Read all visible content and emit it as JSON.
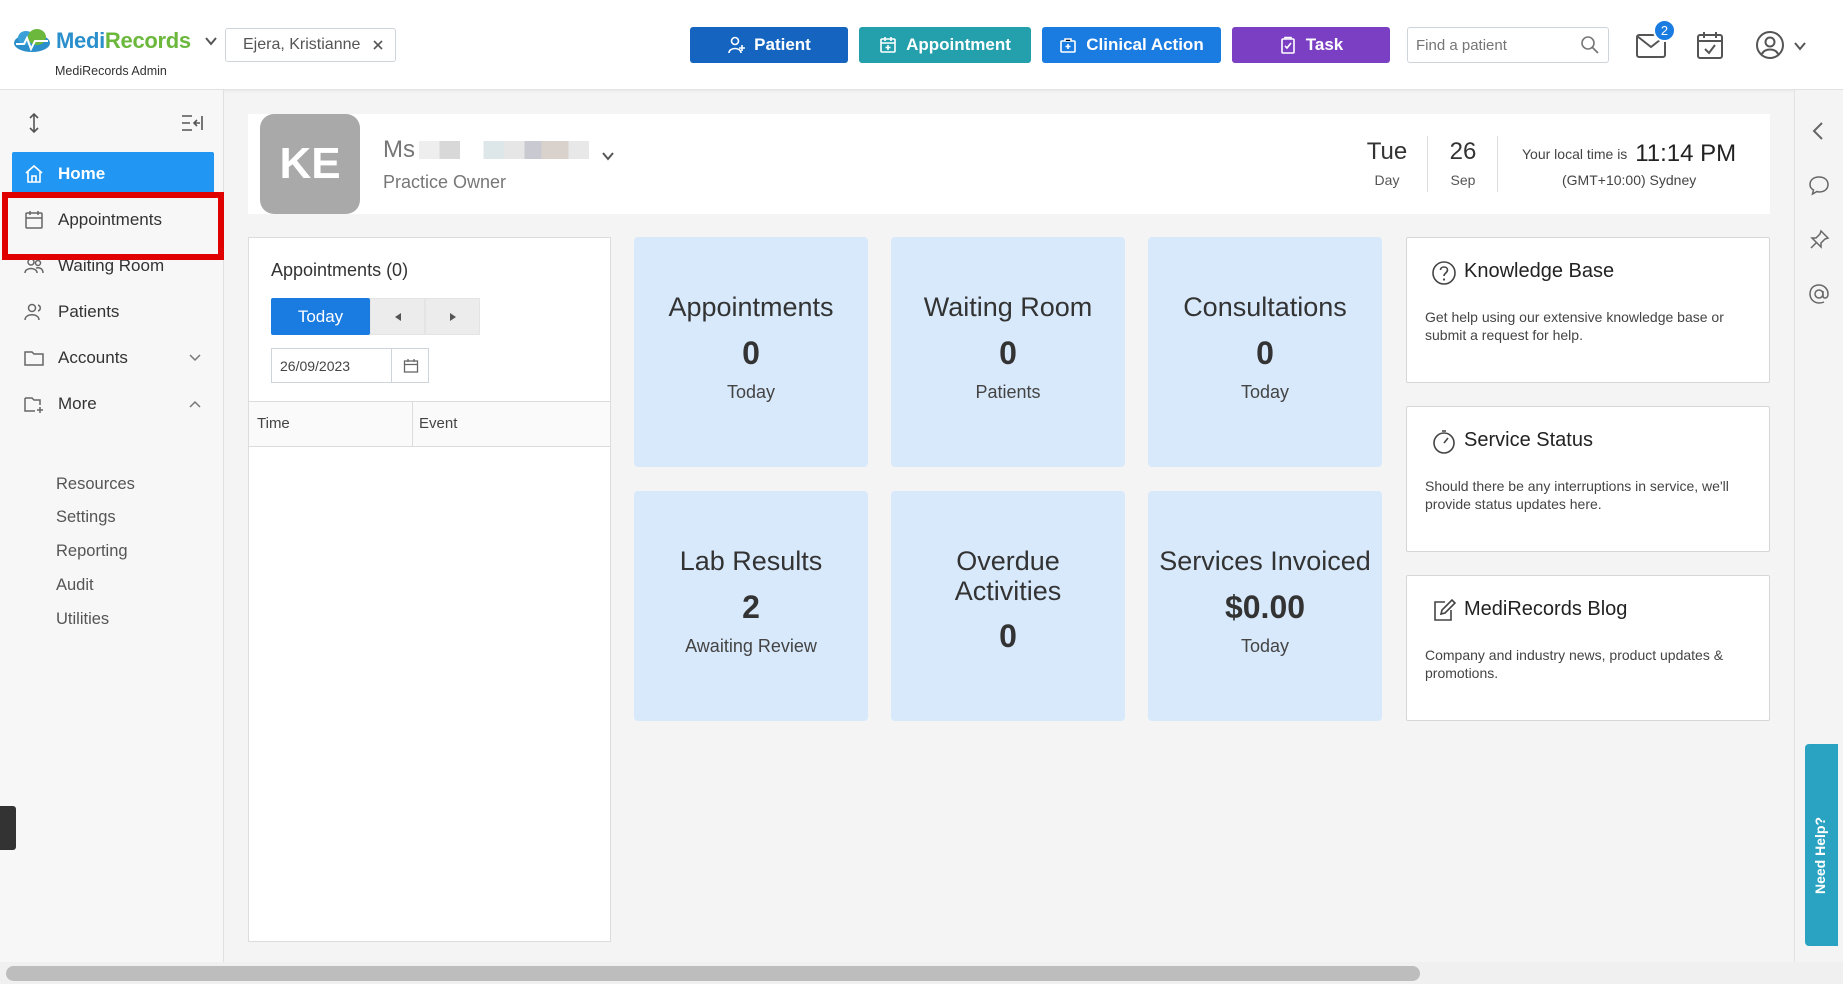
{
  "app": {
    "logo_main": "Medi",
    "logo_accent": "Records",
    "subtitle": "MediRecords Admin"
  },
  "topbar": {
    "patient_chip": "Ejera, Kristianne",
    "buttons": {
      "patient": "Patient",
      "appointment": "Appointment",
      "clinical_action": "Clinical Action",
      "task": "Task"
    },
    "search_placeholder": "Find a patient",
    "mail_badge": "2"
  },
  "sidebar": {
    "items": [
      {
        "label": "Home",
        "icon": "home-icon",
        "active": true
      },
      {
        "label": "Appointments",
        "icon": "calendar-icon"
      },
      {
        "label": "Waiting Room",
        "icon": "people-icon"
      },
      {
        "label": "Patients",
        "icon": "patients-icon"
      },
      {
        "label": "Accounts",
        "icon": "folder-icon"
      },
      {
        "label": "More",
        "icon": "more-icon"
      }
    ],
    "subitems": [
      "Resources",
      "Settings",
      "Reporting",
      "Audit",
      "Utilities"
    ]
  },
  "header": {
    "initials": "KE",
    "name_prefix": "Ms",
    "role": "Practice Owner",
    "day": "Tue",
    "day_label": "Day",
    "date": "26",
    "month": "Sep",
    "local_time_label": "Your local time is",
    "local_time": "11:14 PM",
    "timezone": "(GMT+10:00) Sydney"
  },
  "appointments_panel": {
    "title": "Appointments (0)",
    "today": "Today",
    "date": "26/09/2023",
    "col_time": "Time",
    "col_event": "Event"
  },
  "tiles": [
    {
      "title": "Appointments",
      "value": "0",
      "sub": "Today"
    },
    {
      "title": "Waiting Room",
      "value": "0",
      "sub": "Patients"
    },
    {
      "title": "Consultations",
      "value": "0",
      "sub": "Today"
    },
    {
      "title": "Lab Results",
      "value": "2",
      "sub": "Awaiting Review"
    },
    {
      "title": "Overdue Activities",
      "value": "0",
      "sub": ""
    },
    {
      "title": "Services Invoiced",
      "value": "$0.00",
      "sub": "Today"
    }
  ],
  "cards": [
    {
      "title": "Knowledge Base",
      "desc": "Get help using our extensive knowledge base or submit a request for help."
    },
    {
      "title": "Service Status",
      "desc": "Should there be any interruptions in service, we'll provide status updates here."
    },
    {
      "title": "MediRecords Blog",
      "desc": "Company and industry news, product updates & promotions."
    }
  ],
  "help_tab": "Need Help?",
  "colors": {
    "primary": "#1565c0",
    "accent_blue": "#2196f3",
    "teal": "#24a0ad",
    "purple": "#7b3fc4",
    "tile_bg": "#d8e9fb",
    "highlight": "#e00000"
  }
}
